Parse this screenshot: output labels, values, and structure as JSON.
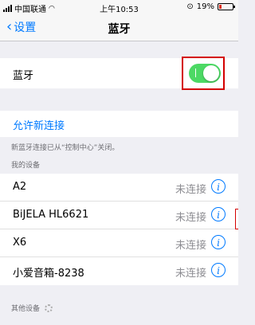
{
  "status": {
    "carrier": "中国联通",
    "time": "上午10:53",
    "battery_percent": "19%",
    "battery_level": 0.19,
    "battery_color": "#e0301e"
  },
  "nav": {
    "back_label": "设置",
    "title": "蓝牙"
  },
  "bluetooth": {
    "label": "蓝牙",
    "enabled": true,
    "toggle_color": "#4cd964"
  },
  "allow": {
    "label": "允许新连接",
    "note": "新蓝牙连接已从“控制中心”关闭。"
  },
  "devices_header": "我的设备",
  "devices": [
    {
      "name": "A2",
      "status": "未连接"
    },
    {
      "name": "BiJELA HL6621",
      "status": "未连接"
    },
    {
      "name": "X6",
      "status": "未连接"
    },
    {
      "name": "小爱音箱-8238",
      "status": "未连接"
    }
  ],
  "others_header": "其他设备",
  "accent_color": "#007aff"
}
